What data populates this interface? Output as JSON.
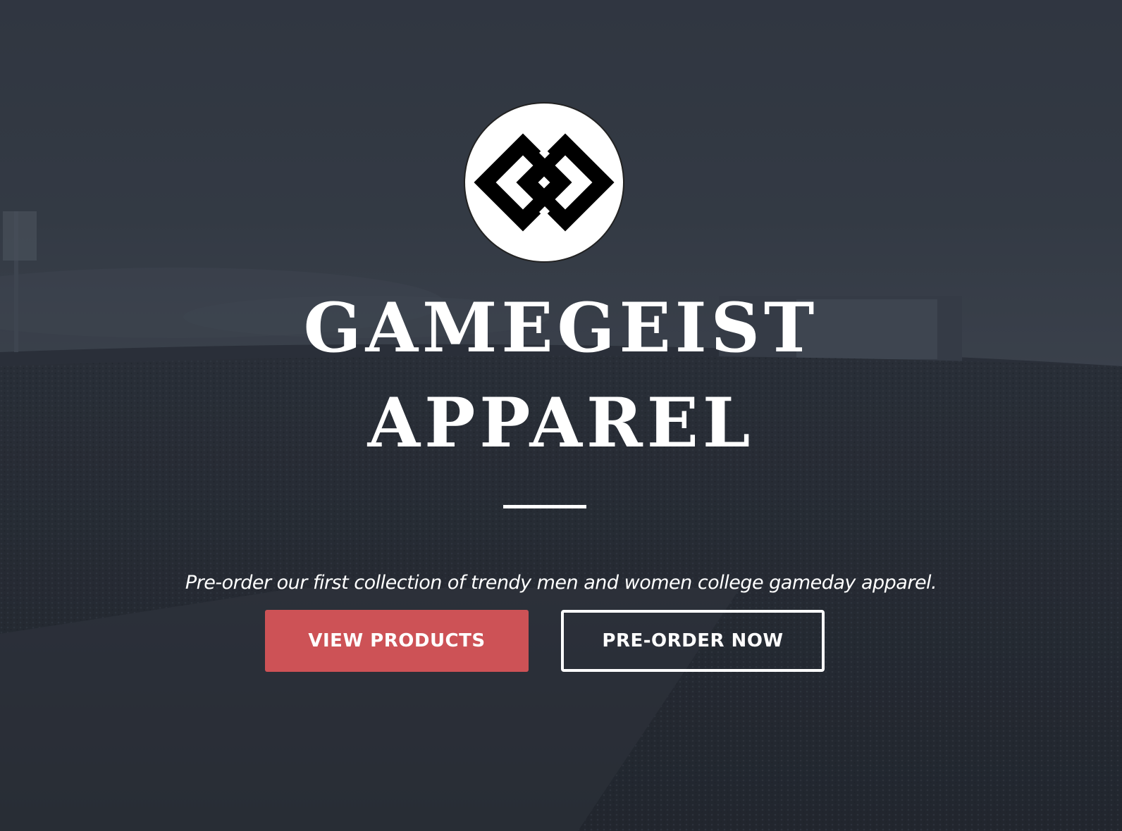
{
  "brand": {
    "logo_icon": "interlocked-diamonds-logo",
    "title_line1": "GAMEGEIST",
    "title_line2": "APPAREL"
  },
  "hero": {
    "tagline": "Pre-order our first collection of trendy men and women college gameday apparel.",
    "primary_button": "VIEW PRODUCTS",
    "secondary_button": "PRE-ORDER NOW"
  },
  "colors": {
    "overlay": "#2f3640",
    "primary_button": "#cd5256",
    "text": "#ffffff"
  }
}
